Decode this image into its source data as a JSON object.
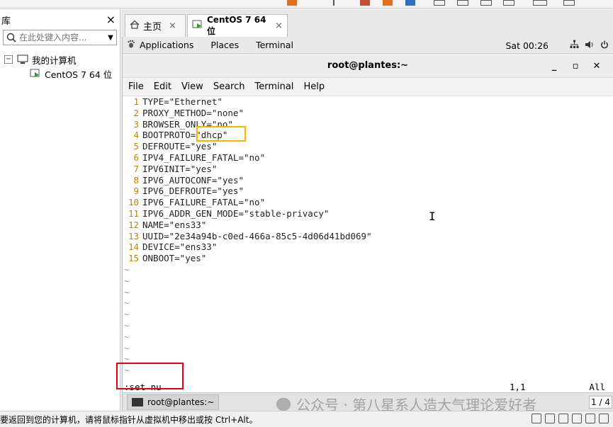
{
  "library": {
    "title": "库",
    "search_placeholder": "在此处键入内容...",
    "tree": [
      {
        "label": "我的计算机"
      },
      {
        "label": "CentOS 7 64 位"
      }
    ]
  },
  "tabs": [
    {
      "label": "主页"
    },
    {
      "label": "CentOS 7 64 位"
    }
  ],
  "gnome": {
    "menus": [
      "Applications",
      "Places",
      "Terminal"
    ],
    "time": "Sat 00:26"
  },
  "terminal": {
    "title": "root@plantes:~",
    "menu": [
      "File",
      "Edit",
      "View",
      "Search",
      "Terminal",
      "Help"
    ]
  },
  "editor": {
    "lines": [
      {
        "n": "1",
        "t": "TYPE=\"Ethernet\""
      },
      {
        "n": "2",
        "t": "PROXY_METHOD=\"none\""
      },
      {
        "n": "3",
        "t": "BROWSER_ONLY=\"no\""
      },
      {
        "n": "4",
        "t": "BOOTPROTO=\"dhcp\""
      },
      {
        "n": "5",
        "t": "DEFROUTE=\"yes\""
      },
      {
        "n": "6",
        "t": "IPV4_FAILURE_FATAL=\"no\""
      },
      {
        "n": "7",
        "t": "IPV6INIT=\"yes\""
      },
      {
        "n": "8",
        "t": "IPV6_AUTOCONF=\"yes\""
      },
      {
        "n": "9",
        "t": "IPV6_DEFROUTE=\"yes\""
      },
      {
        "n": "10",
        "t": "IPV6_FAILURE_FATAL=\"no\""
      },
      {
        "n": "11",
        "t": "IPV6_ADDR_GEN_MODE=\"stable-privacy\""
      },
      {
        "n": "12",
        "t": "NAME=\"ens33\""
      },
      {
        "n": "13",
        "t": "UUID=\"2e34a94b-c0ed-466a-85c5-4d06d41bd069\""
      },
      {
        "n": "14",
        "t": "DEVICE=\"ens33\""
      },
      {
        "n": "15",
        "t": "ONBOOT=\"yes\""
      }
    ],
    "tilde": "~",
    "command": ":set nu",
    "position": "1,1",
    "scroll": "All"
  },
  "taskbar": {
    "task_label": "root@plantes:~",
    "page": "1 / 4"
  },
  "watermark": "公众号 · 第八星系人造大气理论爱好者",
  "status": {
    "message": "要返回到您的计算机，请将鼠标指针从虚拟机中移出或按 Ctrl+Alt。"
  }
}
